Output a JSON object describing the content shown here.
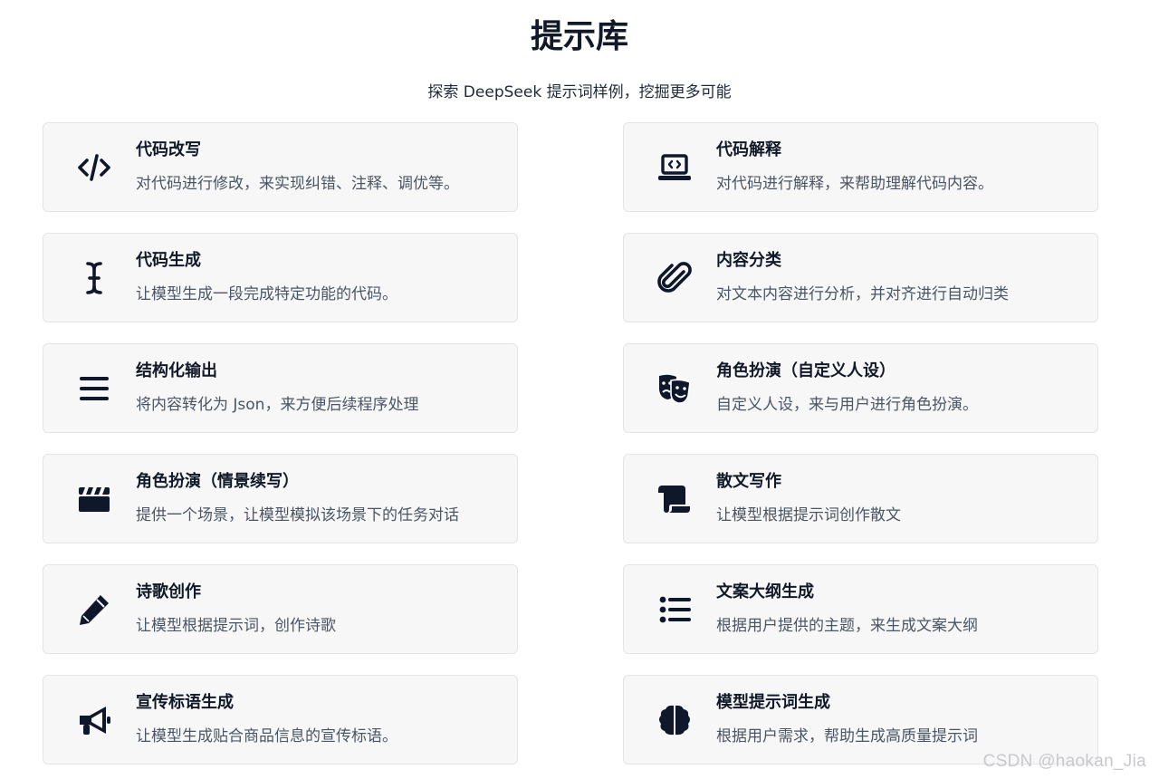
{
  "header": {
    "title": "提示库",
    "subtitle": "探索 DeepSeek 提示词样例，挖掘更多可能"
  },
  "cards": [
    {
      "icon": "code-icon",
      "title": "代码改写",
      "desc": "对代码进行修改，来实现纠错、注释、调优等。"
    },
    {
      "icon": "laptop-code-icon",
      "title": "代码解释",
      "desc": "对代码进行解释，来帮助理解代码内容。"
    },
    {
      "icon": "i-cursor-icon",
      "title": "代码生成",
      "desc": "让模型生成一段完成特定功能的代码。"
    },
    {
      "icon": "paperclip-icon",
      "title": "内容分类",
      "desc": "对文本内容进行分析，并对齐进行自动归类"
    },
    {
      "icon": "bars-icon",
      "title": "结构化输出",
      "desc": "将内容转化为 Json，来方便后续程序处理"
    },
    {
      "icon": "theater-masks-icon",
      "title": "角色扮演（自定义人设）",
      "desc": "自定义人设，来与用户进行角色扮演。"
    },
    {
      "icon": "clapperboard-icon",
      "title": "角色扮演（情景续写）",
      "desc": "提供一个场景，让模型模拟该场景下的任务对话"
    },
    {
      "icon": "scroll-icon",
      "title": "散文写作",
      "desc": "让模型根据提示词创作散文"
    },
    {
      "icon": "pencil-icon",
      "title": "诗歌创作",
      "desc": "让模型根据提示词，创作诗歌"
    },
    {
      "icon": "list-icon",
      "title": "文案大纲生成",
      "desc": "根据用户提供的主题，来生成文案大纲"
    },
    {
      "icon": "bullhorn-icon",
      "title": "宣传标语生成",
      "desc": "让模型生成贴合商品信息的宣传标语。"
    },
    {
      "icon": "brain-icon",
      "title": "模型提示词生成",
      "desc": "根据用户需求，帮助生成高质量提示词"
    }
  ],
  "watermark": "CSDN @haokan_Jia",
  "colors": {
    "card_background": "#f7f7f8",
    "card_border": "#e3e4e8",
    "title": "#111827",
    "description": "#4b5563",
    "icon": "#0f172a"
  }
}
